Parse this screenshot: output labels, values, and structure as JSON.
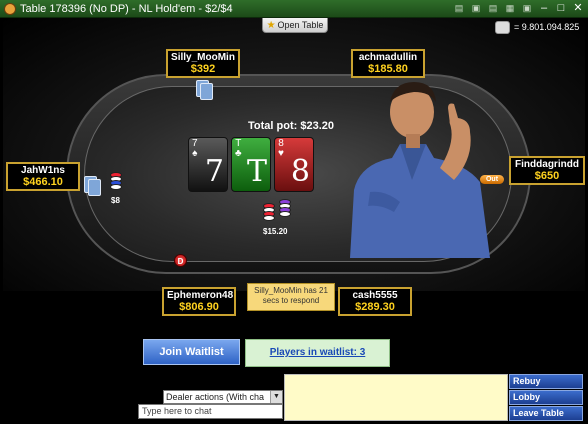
{
  "window": {
    "title": "Table  178396 (No DP)  -  NL  Hold'em - $2/$4",
    "controls": [
      "▤",
      "–",
      "□",
      "✕"
    ]
  },
  "toolbar": {
    "open_table_label": "Open Table",
    "balance": "= 9.801.094.825"
  },
  "table": {
    "total_pot": "Total pot: $23.20",
    "board": [
      {
        "rank": "7",
        "suit": "♠",
        "color": "black",
        "big": "7"
      },
      {
        "rank": "T",
        "suit": "♣",
        "color": "green",
        "big": "T"
      },
      {
        "rank": "8",
        "suit": "♥",
        "color": "red",
        "big": "8"
      }
    ],
    "pot_chips_label": "$15.20",
    "left_chips_label": "$8",
    "dealer_button": "D",
    "out_badge": "Out"
  },
  "seats": [
    {
      "name": "Silly_MooMin",
      "stack": "$392"
    },
    {
      "name": "achmadullin",
      "stack": "$185.80"
    },
    {
      "name": "JahW1ns",
      "stack": "$466.10"
    },
    {
      "name": "Finddagrindd",
      "stack": "$650"
    },
    {
      "name": "Ephemeron48",
      "stack": "$806.90"
    },
    {
      "name": "cash5555",
      "stack": "$289.30"
    }
  ],
  "timer_message": "Silly_MooMin has 21 secs to respond",
  "waitlist": {
    "join_label": "Join Waitlist",
    "players_label": "Players in waitlist: 3"
  },
  "chat": {
    "dealer_filter_value": "Dealer actions (With cha",
    "input_placeholder": "Type here to chat"
  },
  "side_buttons": {
    "rebuy": "Rebuy",
    "lobby": "Lobby",
    "leave": "Leave Table"
  },
  "colors": {
    "seat_border": "#c9a230",
    "stack_text": "#ffd21f",
    "title_bar": "#2f6d2a",
    "timer_bg": "#f7d87b",
    "chat_bg": "#fffbc8"
  }
}
